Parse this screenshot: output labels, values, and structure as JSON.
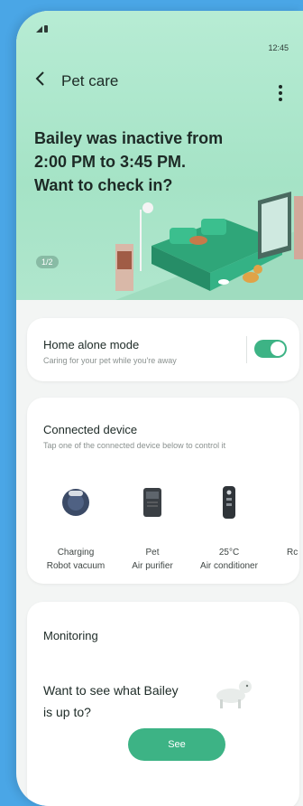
{
  "status_bar": {
    "time": "12:45"
  },
  "header": {
    "title": "Pet care"
  },
  "hero": {
    "headline": "Bailey was inactive from 2:00 PM to 3:45 PM. Want to check in?",
    "pager": "1/2"
  },
  "home_alone": {
    "title": "Home alone mode",
    "subtitle": "Caring for your pet while you're away",
    "enabled": true
  },
  "connected": {
    "title": "Connected device",
    "subtitle": "Tap one of the connected device below to control it",
    "devices": [
      {
        "line1": "Charging",
        "line2": "Robot vacuum",
        "icon": "robot-vacuum-icon"
      },
      {
        "line1": "Pet",
        "line2": "Air purifier",
        "icon": "air-purifier-icon"
      },
      {
        "line1": "25°C",
        "line2": "Air conditioner",
        "icon": "air-conditioner-icon"
      },
      {
        "line1": "",
        "line2": "Rc",
        "icon": "device-icon"
      }
    ]
  },
  "monitoring": {
    "title": "Monitoring",
    "text": "Want to see what Bailey is up to?",
    "button": "See"
  },
  "colors": {
    "accent": "#3db385",
    "hero_bg": "#a5e3c6",
    "page_bg": "#4aa6e6"
  }
}
